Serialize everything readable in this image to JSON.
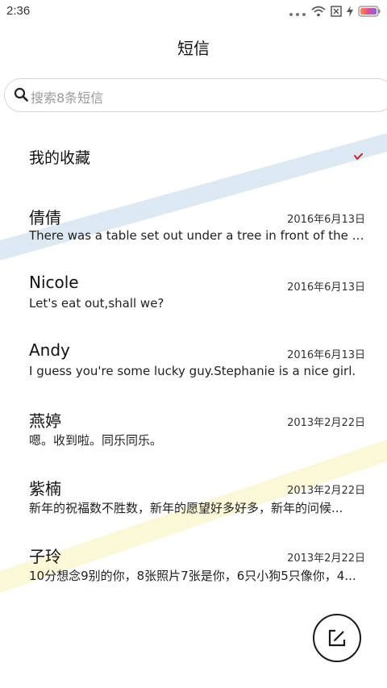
{
  "status_bar": {
    "time": "2:36"
  },
  "header": {
    "title": "短信"
  },
  "search": {
    "placeholder": "搜索8条短信"
  },
  "favorites": {
    "label": "我的收藏"
  },
  "conversations": [
    {
      "name": "倩倩",
      "date": "2016年6月13日",
      "preview": "There was a table set out under a tree in front of the ho..."
    },
    {
      "name": "Nicole",
      "date": "2016年6月13日",
      "preview": "Let's eat out,shall we?"
    },
    {
      "name": "Andy",
      "date": "2016年6月13日",
      "preview": "I guess you're some lucky guy.Stephanie is a nice girl."
    },
    {
      "name": "燕婷",
      "date": "2013年2月22日",
      "preview": "嗯。收到啦。同乐同乐。"
    },
    {
      "name": "紫楠",
      "date": "2013年2月22日",
      "preview": "新年的祝福数不胜数，新年的愿望好多好多，新年的问候..."
    },
    {
      "name": "子玲",
      "date": "2013年2月22日",
      "preview": "10分想念9别的你，8张照片7张是你，6只小狗5只像你，4..."
    }
  ],
  "colors": {
    "accent_red": "#c62828",
    "stripe_blue": "#dce9f2",
    "stripe_yellow": "#fbf8d8"
  },
  "icons": [
    "wifi-icon",
    "sim-off-icon",
    "charging-icon",
    "battery-icon",
    "search-icon",
    "chevron-down-icon",
    "compose-icon"
  ]
}
